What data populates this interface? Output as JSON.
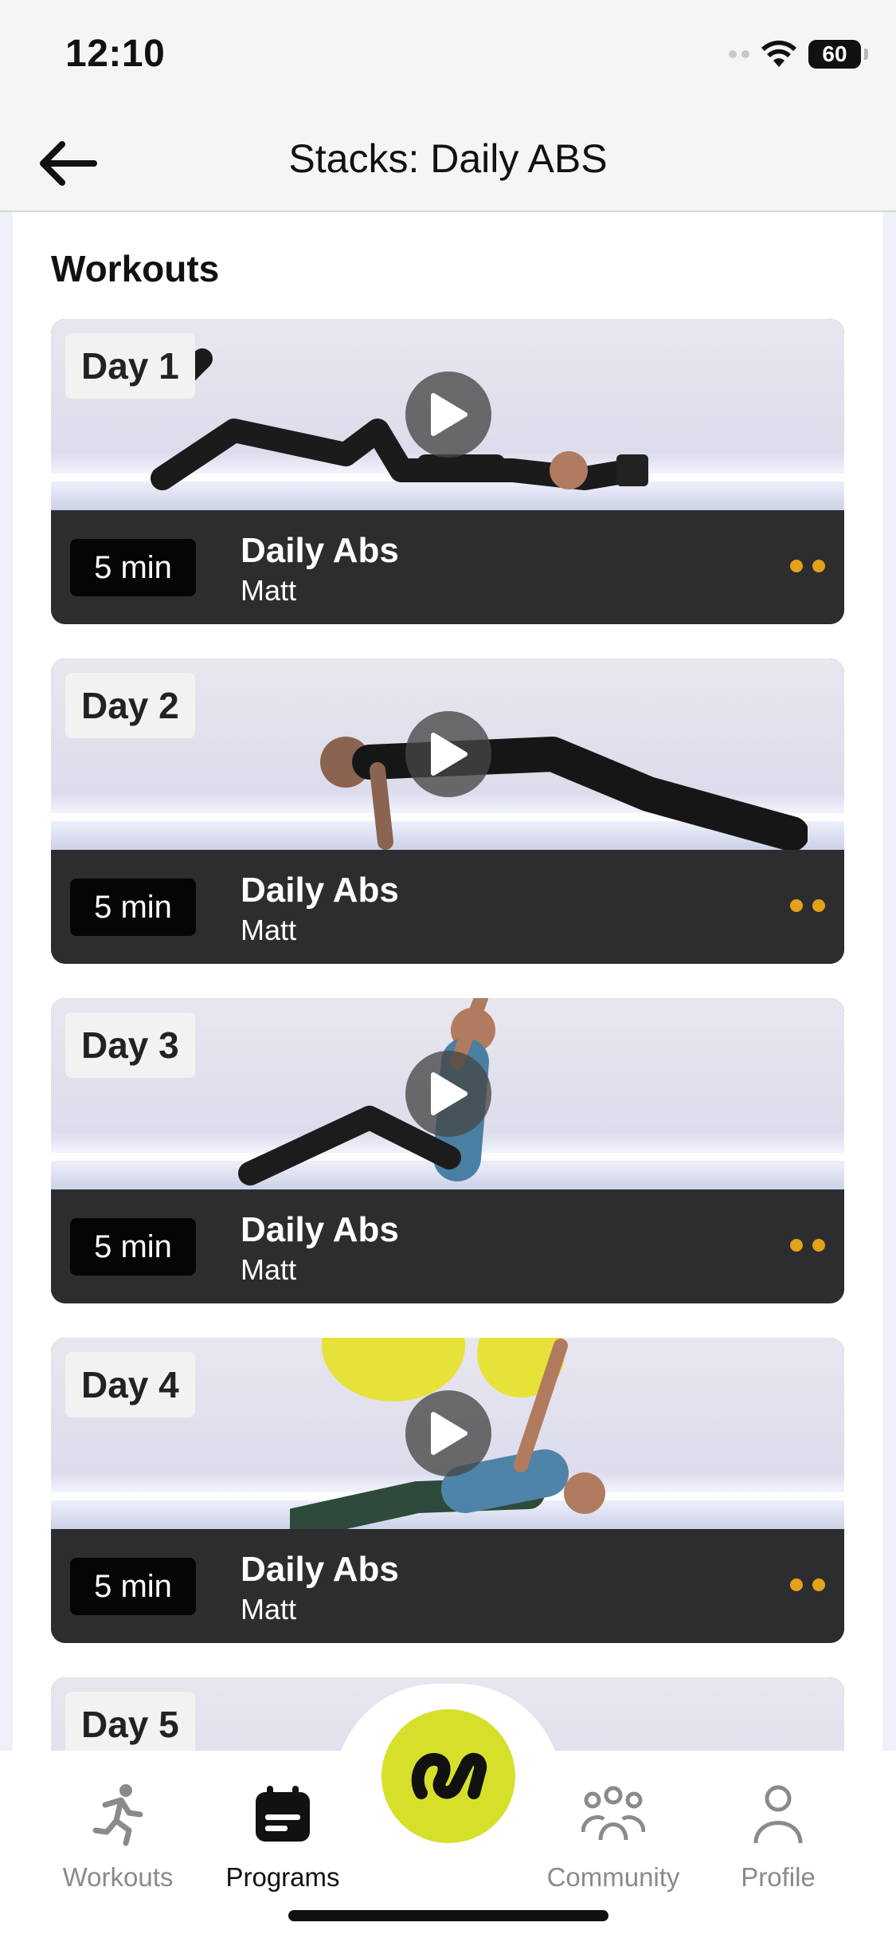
{
  "status_bar": {
    "time": "12:10",
    "battery": "60"
  },
  "header": {
    "title": "Stacks: Daily ABS",
    "back_icon": "arrow-left-icon"
  },
  "section": {
    "title": "Workouts"
  },
  "workouts": [
    {
      "day": "Day 1",
      "duration": "5 min",
      "title": "Daily Abs",
      "coach": "Matt"
    },
    {
      "day": "Day 2",
      "duration": "5 min",
      "title": "Daily Abs",
      "coach": "Matt"
    },
    {
      "day": "Day 3",
      "duration": "5 min",
      "title": "Daily Abs",
      "coach": "Matt"
    },
    {
      "day": "Day 4",
      "duration": "5 min",
      "title": "Daily Abs",
      "coach": "Matt"
    },
    {
      "day": "Day 5"
    }
  ],
  "tabs": [
    {
      "label": "Workouts",
      "icon": "running-person-icon",
      "active": false
    },
    {
      "label": "Programs",
      "icon": "calendar-icon",
      "active": true
    },
    {
      "label": "Community",
      "icon": "people-icon",
      "active": false
    },
    {
      "label": "Profile",
      "icon": "person-icon",
      "active": false
    }
  ],
  "colors": {
    "accent": "#d6e02a",
    "dots": "#e3a21a",
    "card_bg": "#2d2d2f"
  }
}
